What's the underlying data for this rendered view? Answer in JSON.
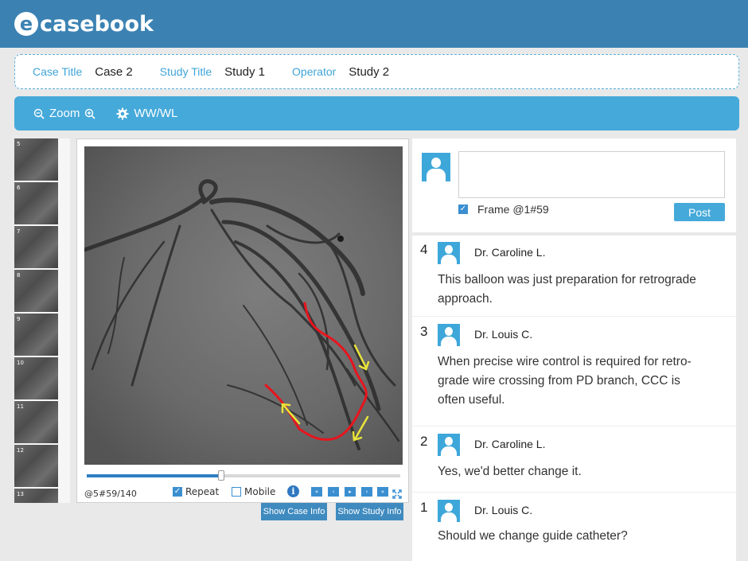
{
  "brand": {
    "logo_letter": "e",
    "logo_text": "casebook"
  },
  "info": {
    "case_title_label": "Case Title",
    "case_title_value": "Case 2",
    "study_title_label": "Study Title",
    "study_title_value": "Study 1",
    "operator_label": "Operator",
    "operator_value": "Study 2"
  },
  "toolbar": {
    "zoom_label": "Zoom",
    "wwwl_label": "WW/WL"
  },
  "thumbnails": [
    "5",
    "6",
    "7",
    "8",
    "9",
    "10",
    "11",
    "12",
    "13"
  ],
  "viewer": {
    "frame_label": "@5#59/140",
    "repeat_label": "Repeat",
    "mobile_label": "Mobile",
    "info_glyph": "i",
    "progress": 0.43,
    "nav": [
      "«",
      "‹",
      "▸",
      "›",
      "»"
    ]
  },
  "buttons": {
    "show_case_info": "Show Case Info",
    "show_study_info": "Show Study Info"
  },
  "form": {
    "frame_label": "Frame @1#59",
    "post_label": "Post"
  },
  "comments": [
    {
      "num": "4",
      "author": "Dr. Caroline L.",
      "lines": [
        "This balloon was just preparation for retrograde",
        "approach."
      ]
    },
    {
      "num": "3",
      "author": "Dr. Louis C.",
      "lines": [
        "When precise wire control is required for retro-",
        "grade wire crossing from PD branch, CCC is",
        "often useful."
      ]
    },
    {
      "num": "2",
      "author": "Dr. Caroline L.",
      "lines": [
        "Yes, we'd better change it."
      ]
    },
    {
      "num": "1",
      "author": "Dr. Louis C.",
      "lines": [
        "Should we change guide catheter?"
      ]
    }
  ],
  "colors": {
    "header": "#3b82b3",
    "accent": "#45a9da",
    "annotation_red": "#e8141e",
    "annotation_yellow": "#e9e43a"
  }
}
